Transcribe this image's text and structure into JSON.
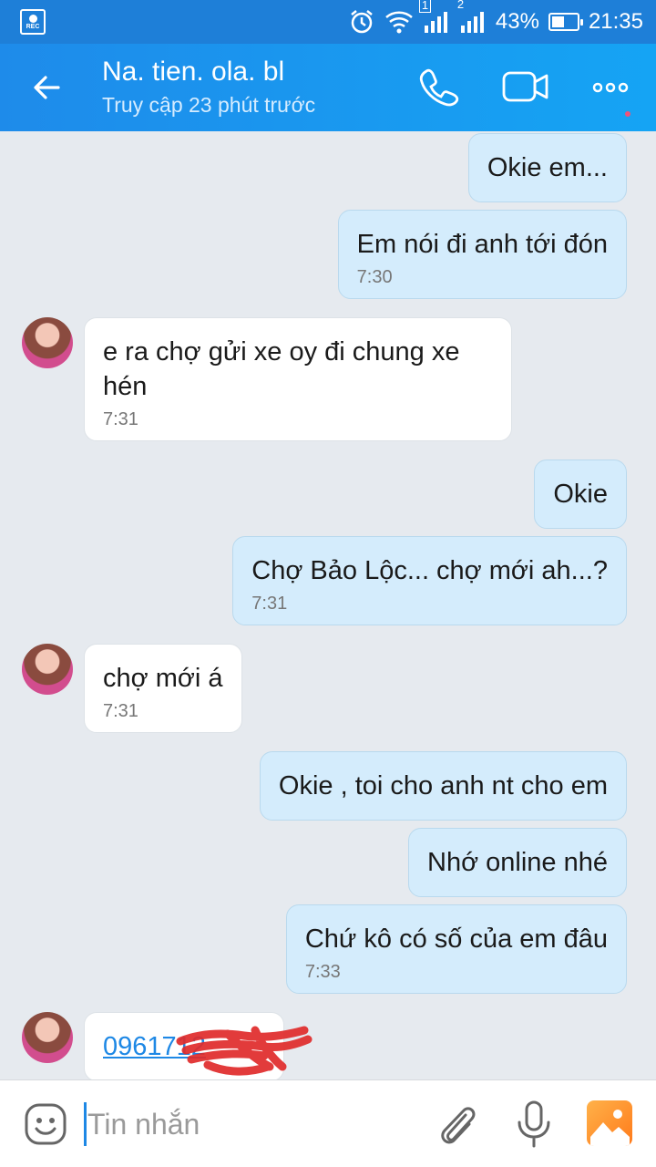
{
  "status": {
    "battery": "43%",
    "time": "21:35",
    "sim1": "1",
    "sim2": "2",
    "rec_label": "REC"
  },
  "header": {
    "title": "Na. tien. ola. bl",
    "subtitle": "Truy cập 23 phút trước"
  },
  "messages": [
    {
      "text": "Okie em...",
      "time": ""
    },
    {
      "text": "Em nói đi anh tới đón",
      "time": "7:30"
    },
    {
      "text": "e ra chợ gửi xe oy đi chung xe hén",
      "time": "7:31"
    },
    {
      "text": "Okie",
      "time": ""
    },
    {
      "text": "Chợ Bảo Lộc... chợ mới ah...?",
      "time": "7:31"
    },
    {
      "text": "chợ mới á",
      "time": "7:31"
    },
    {
      "text": "Okie , toi cho anh nt cho em",
      "time": ""
    },
    {
      "text": "Nhớ online nhé",
      "time": ""
    },
    {
      "text": "Chứ kô có số của em đâu",
      "time": "7:33"
    },
    {
      "text": "0961712",
      "time": ""
    }
  ],
  "input": {
    "placeholder": "Tin nhắn"
  },
  "colors": {
    "header": "#1e8bea",
    "outgoing_bubble": "#d4ecfc",
    "incoming_bubble": "#ffffff",
    "link": "#1e88e5"
  }
}
